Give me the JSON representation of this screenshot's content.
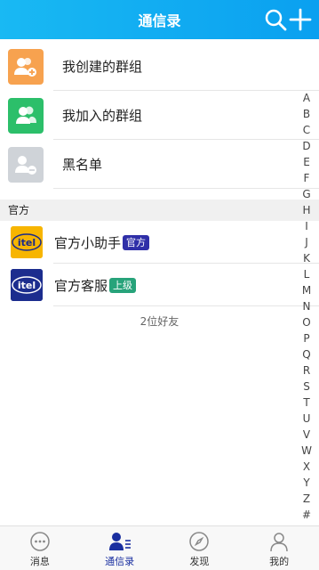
{
  "header": {
    "title": "通信录"
  },
  "groups": [
    {
      "label": "我创建的群组",
      "color": "#f7a24f"
    },
    {
      "label": "我加入的群组",
      "color": "#2cbf6a"
    },
    {
      "label": "黑名单",
      "color": "#cfd3d8"
    }
  ],
  "section": {
    "title": "官方"
  },
  "official": [
    {
      "name": "官方小助手",
      "badge": "官方",
      "badge_color": "#2f2fa8",
      "logo": "itel"
    },
    {
      "name": "官方客服",
      "badge": "上级",
      "badge_color": "#27a37a",
      "logo": "itel"
    }
  ],
  "friend_count": "2位好友",
  "index": [
    "A",
    "B",
    "C",
    "D",
    "E",
    "F",
    "G",
    "H",
    "I",
    "J",
    "K",
    "L",
    "M",
    "N",
    "O",
    "P",
    "Q",
    "R",
    "S",
    "T",
    "U",
    "V",
    "W",
    "X",
    "Y",
    "Z",
    "#"
  ],
  "tabs": [
    {
      "label": "消息",
      "icon": "chat-bubble-icon"
    },
    {
      "label": "通信录",
      "icon": "contacts-icon"
    },
    {
      "label": "发现",
      "icon": "compass-icon"
    },
    {
      "label": "我的",
      "icon": "person-icon"
    }
  ],
  "colors": {
    "header": "#0aa0f0",
    "active_tab": "#1a2fa0"
  }
}
